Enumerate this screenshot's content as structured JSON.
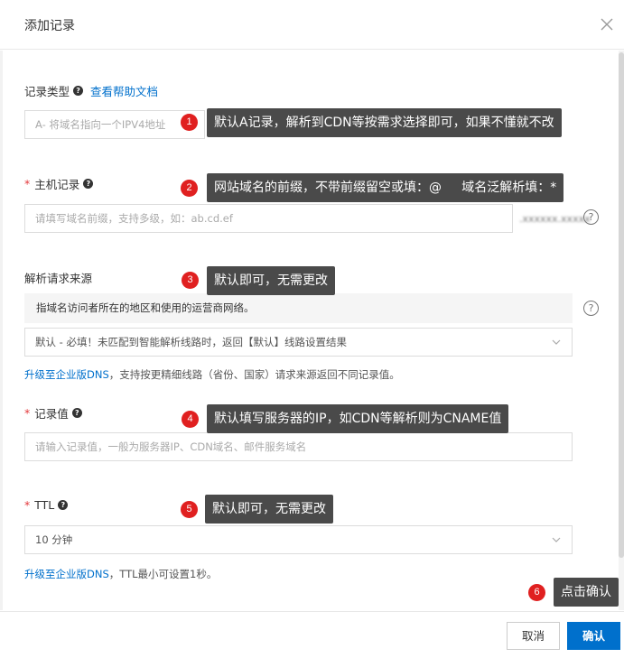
{
  "dialog": {
    "title": "添加记录"
  },
  "fields": {
    "record_type": {
      "label": "记录类型",
      "help_link": "查看帮助文档",
      "value": "A- 将域名指向一个IPV4地址"
    },
    "host": {
      "required_mark": "*",
      "label": "主机记录",
      "placeholder": "请填写域名前缀，支持多级，如：ab.cd.ef"
    },
    "source": {
      "label": "解析请求来源",
      "description": "指域名访问者所在的地区和使用的运营商网络。",
      "value": "默认 - 必填！未匹配到智能解析线路时，返回【默认】线路设置结果",
      "upgrade_link": "升级至企业版DNS",
      "upgrade_text": "，支持按更精细线路（省份、国家）请求来源返回不同记录值。"
    },
    "record_value": {
      "required_mark": "*",
      "label": "记录值",
      "placeholder": "请输入记录值，一般为服务器IP、CDN域名、邮件服务域名"
    },
    "ttl": {
      "required_mark": "*",
      "label": "TTL",
      "value": "10 分钟",
      "upgrade_link": "升级至企业版DNS",
      "upgrade_text": "，TTL最小可设置1秒。"
    }
  },
  "annotations": [
    {
      "number": "1",
      "text": "默认A记录，解析到CDN等按需求选择即可，如果不懂就不改"
    },
    {
      "number": "2",
      "text": "网站域名的前缀，不带前缀留空或填：@     域名泛解析填：*"
    },
    {
      "number": "3",
      "text": "默认即可，无需更改"
    },
    {
      "number": "4",
      "text": "默认填写服务器的IP，如CDN等解析则为CNAME值"
    },
    {
      "number": "5",
      "text": "默认即可，无需更改"
    },
    {
      "number": "6",
      "text": "点击确认"
    }
  ],
  "footer": {
    "cancel": "取消",
    "confirm": "确认"
  },
  "colors": {
    "accent": "#0070cc",
    "badge": "#e02020",
    "callout": "#4a4a4a",
    "required": "#e4393c"
  }
}
